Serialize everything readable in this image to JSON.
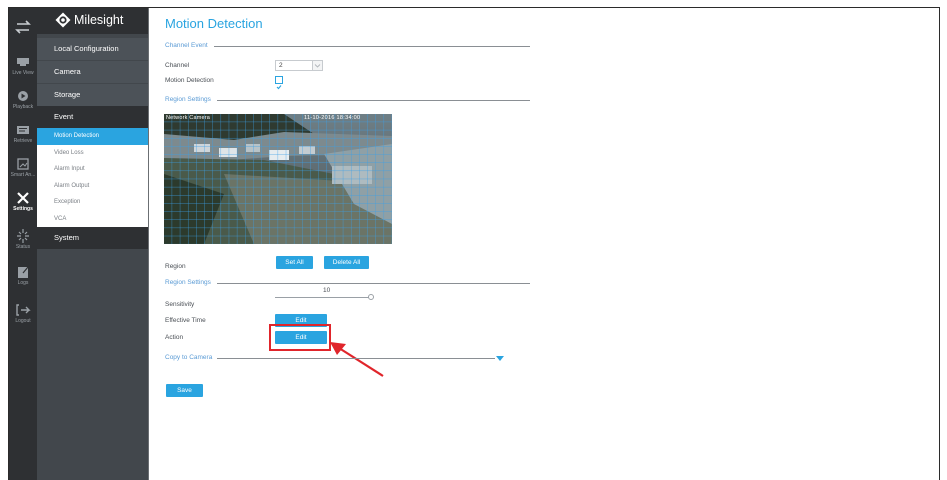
{
  "brand": {
    "name": "Milesight"
  },
  "rail": [
    {
      "label": "",
      "icon": "swap-arrows-icon"
    },
    {
      "label": "Live View",
      "icon": "live-view-icon"
    },
    {
      "label": "Playback",
      "icon": "playback-icon"
    },
    {
      "label": "Retrieve",
      "icon": "retrieve-icon"
    },
    {
      "label": "Smart An...",
      "icon": "smart-analysis-icon"
    },
    {
      "label": "Settings",
      "icon": "settings-icon"
    },
    {
      "label": "Status",
      "icon": "status-icon"
    },
    {
      "label": "Logs",
      "icon": "logs-icon"
    },
    {
      "label": "Logout",
      "icon": "logout-icon"
    }
  ],
  "sidebar": {
    "sections": [
      "Local Configuration",
      "Camera",
      "Storage",
      "Event",
      "System"
    ],
    "event_items": [
      "Motion Detection",
      "Video Loss",
      "Alarm Input",
      "Alarm Output",
      "Exception",
      "VCA"
    ],
    "active_item": "Motion Detection"
  },
  "main": {
    "title": "Motion Detection",
    "channel_event_group": "Channel Event",
    "channel_label": "Channel",
    "channel_value": "2",
    "motion_label": "Motion Detection",
    "motion_enabled": true,
    "region_group": "Region Settings",
    "preview_overlay": "Network Camera",
    "preview_time": "11-10-2016 18:34:00",
    "region_label": "Region",
    "set_all": "Set All",
    "delete_all": "Delete All",
    "region_group_2": "Region Settings",
    "sensitivity_label": "Sensitivity",
    "sensitivity_value": "10",
    "effective_time_label": "Effective Time",
    "edit_label": "Edit",
    "action_label": "Action",
    "copy_label": "Copy to Camera",
    "save_label": "Save"
  },
  "colors": {
    "accent": "#2aa4e0",
    "sidebar": "#42474c",
    "rail": "#2e3033",
    "highlight": "#e0252b"
  }
}
